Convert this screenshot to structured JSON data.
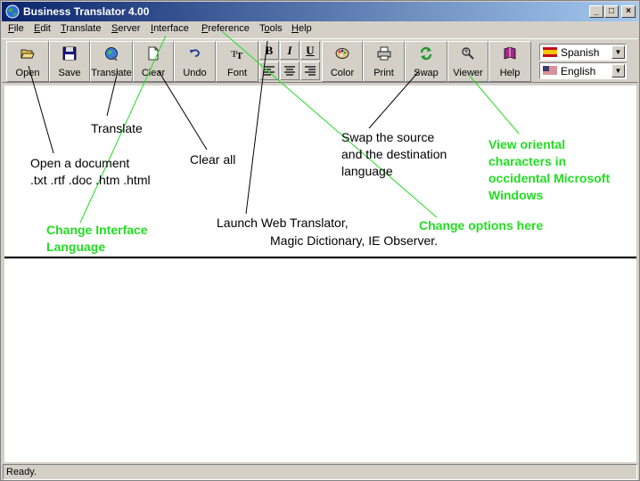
{
  "window": {
    "title": "Business Translator 4.00",
    "buttons": [
      "_",
      "□",
      "×"
    ]
  },
  "menu": [
    {
      "name": "file",
      "pre": "",
      "key": "F",
      "post": "ile"
    },
    {
      "name": "edit",
      "pre": "",
      "key": "E",
      "post": "dit"
    },
    {
      "name": "translate",
      "pre": "",
      "key": "T",
      "post": "ranslate"
    },
    {
      "name": "server",
      "pre": "",
      "key": "S",
      "post": "erver"
    },
    {
      "name": "interface",
      "pre": "",
      "key": "I",
      "post": "nterface"
    },
    {
      "name": "preference",
      "pre": "",
      "key": "P",
      "post": "reference"
    },
    {
      "name": "tools",
      "pre": "T",
      "key": "o",
      "post": "ols"
    },
    {
      "name": "help",
      "pre": "",
      "key": "H",
      "post": "elp"
    }
  ],
  "toolbar": {
    "open": "Open",
    "save": "Save",
    "translate": "Translate",
    "clear": "Clear",
    "undo": "Undo",
    "font": "Font",
    "color": "Color",
    "print": "Print",
    "swap": "Swap",
    "viewer": "Viewer",
    "help": "Help",
    "bold": "B",
    "italic": "I",
    "underline": "U",
    "icons": [
      "folder-open-icon",
      "floppy-disk-icon",
      "globe-translate-icon",
      "blank-page-icon",
      "undo-arrow-icon",
      "font-tt-icon",
      "paint-palette-icon",
      "printer-icon",
      "swap-arrows-icon",
      "viewer-icon",
      "help-book-icon"
    ]
  },
  "languages": {
    "source": "Spanish",
    "target": "English"
  },
  "status": "Ready.",
  "annotations": {
    "translate": "Translate",
    "clear_all": "Clear all",
    "open_line1": "Open a document",
    "open_line2": ".txt .rtf .doc .htm .html",
    "swap_line1": "Swap the source",
    "swap_line2": "and the destination",
    "swap_line3": "language",
    "viewer_line1": "View oriental",
    "viewer_line2": "characters in",
    "viewer_line3": "occidental Microsoft",
    "viewer_line4": "Windows",
    "interface_line1": "Change Interface",
    "interface_line2": "Language",
    "tools_line1": "Launch Web Translator,",
    "tools_line2": "Magic Dictionary,  IE Observer.",
    "preference": "Change options here"
  },
  "colors": {
    "titlebar_start": "#0a246a",
    "titlebar_end": "#a6caf0",
    "annotation_green": "#22dd22",
    "face": "#d4d0c8"
  }
}
